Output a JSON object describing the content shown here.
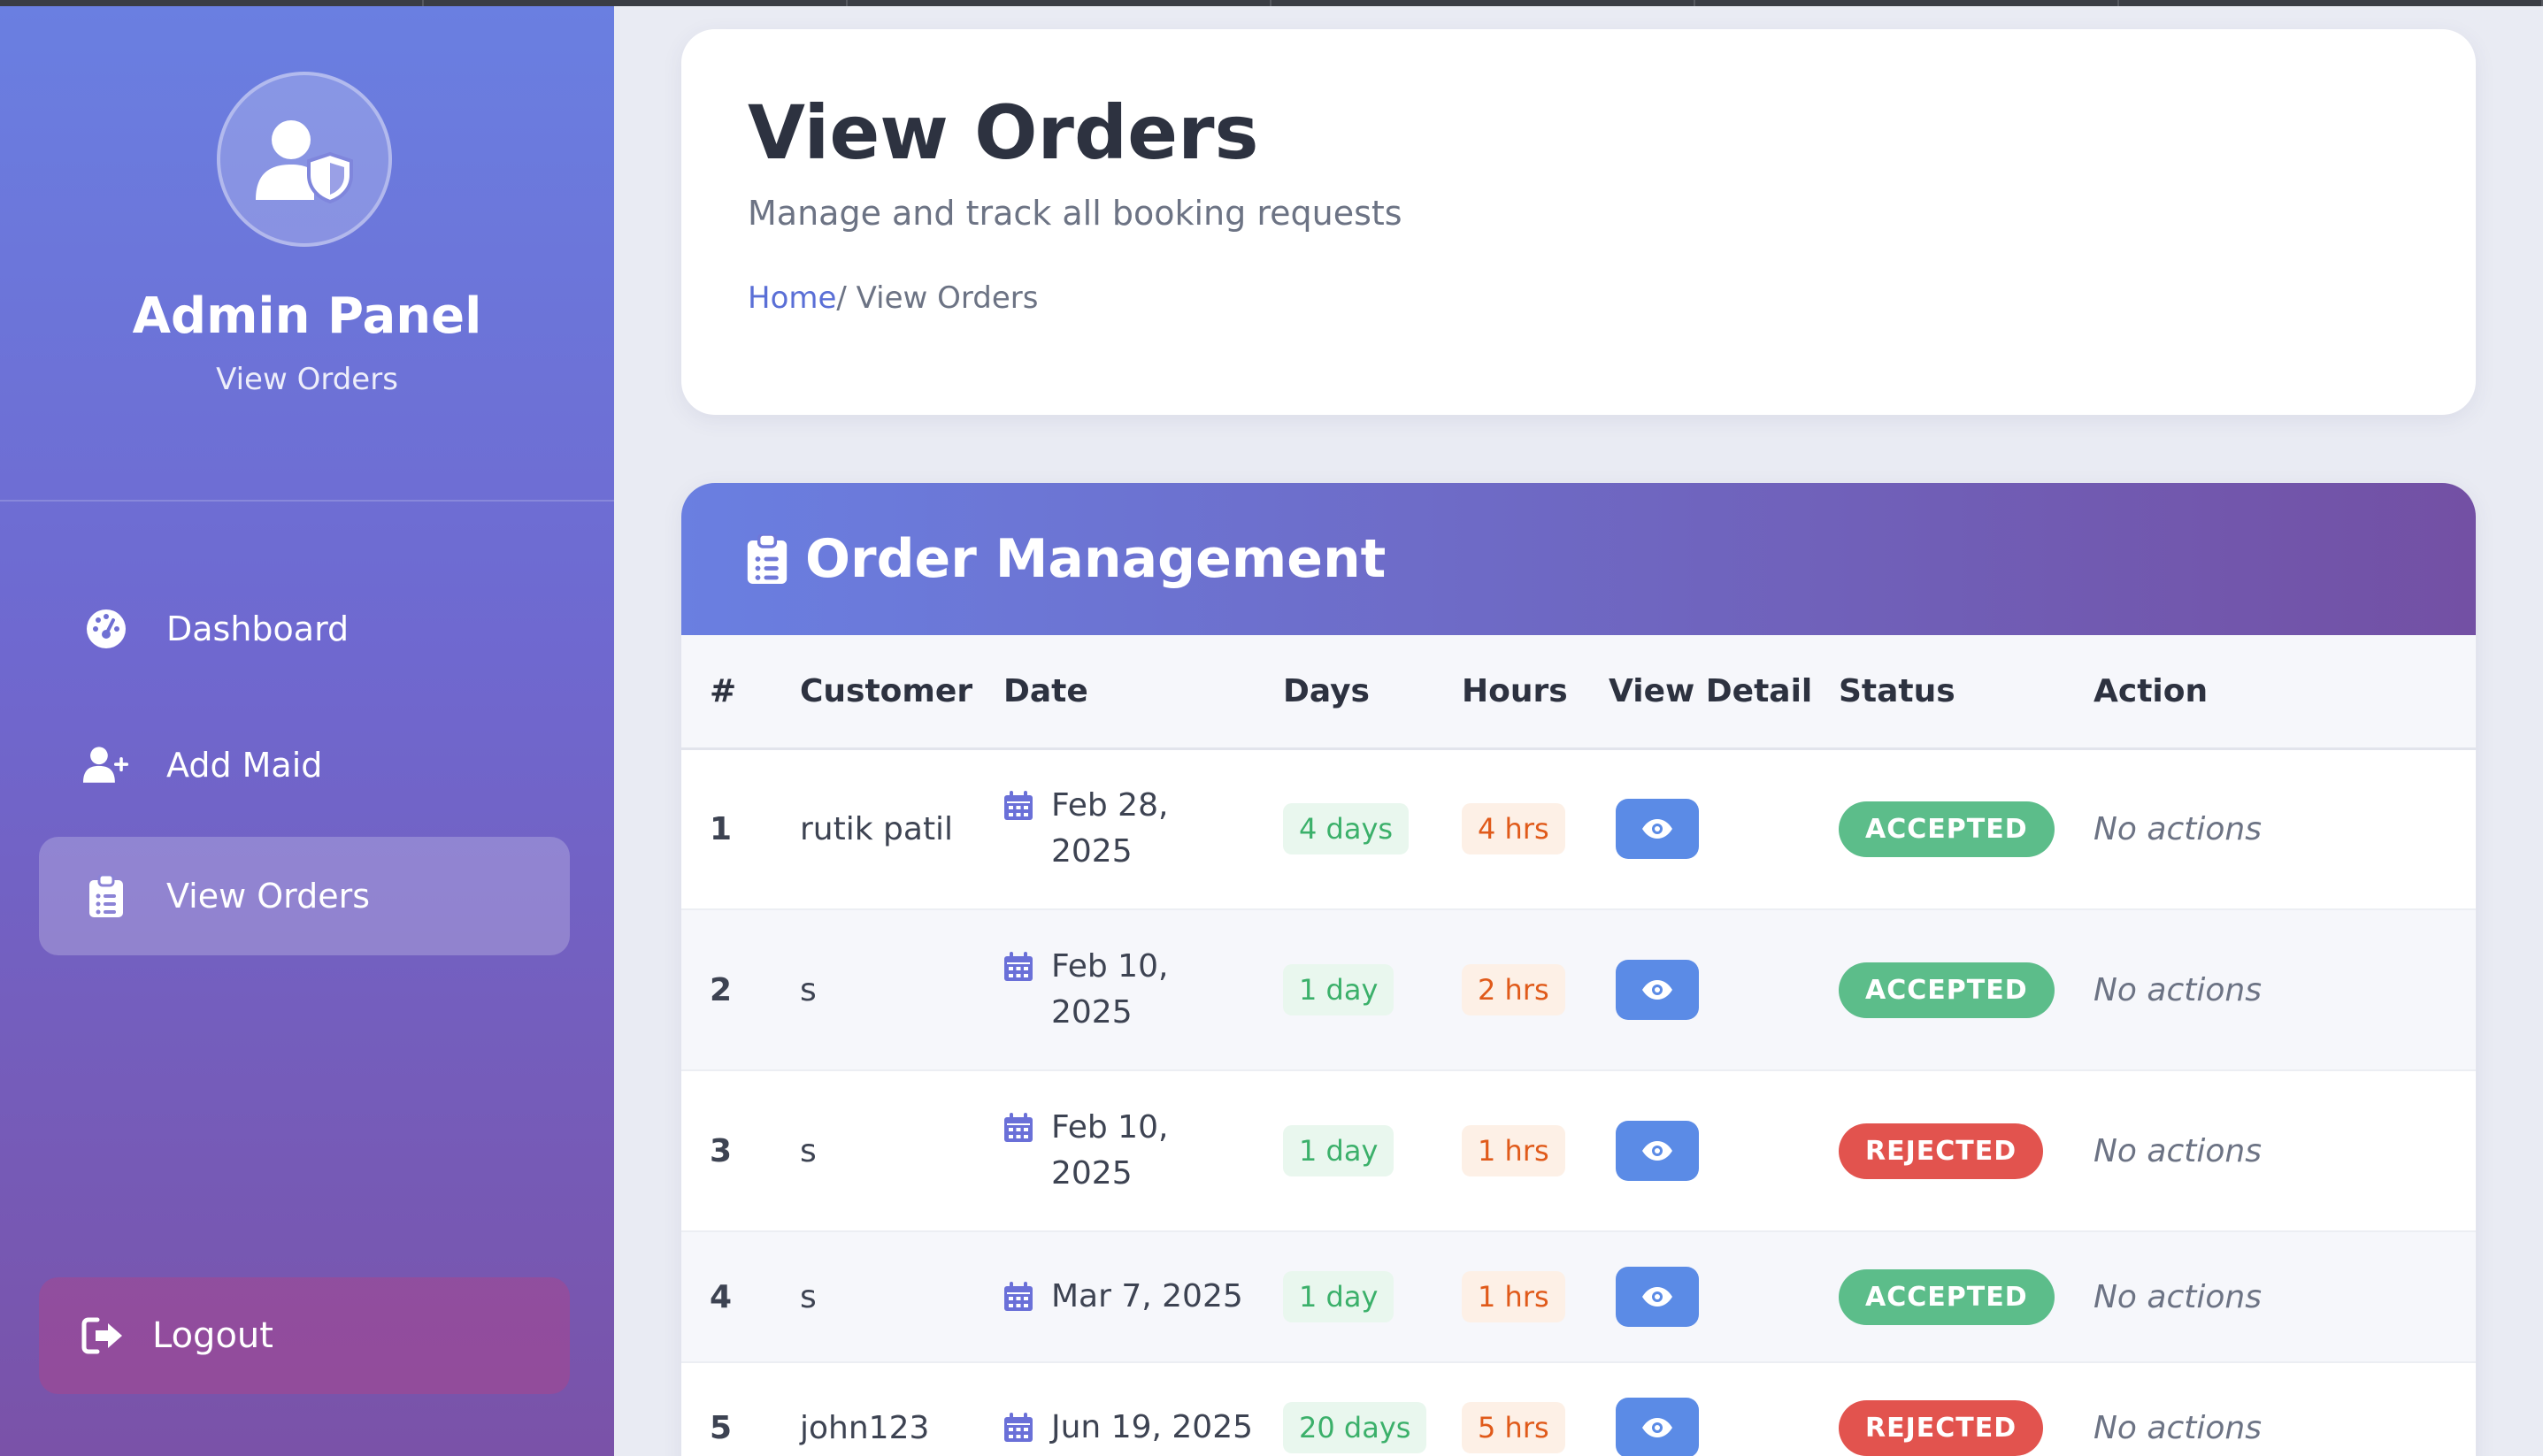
{
  "sidebar": {
    "brand_title": "Admin Panel",
    "brand_subtitle": "View Orders",
    "nav": [
      {
        "label": "Dashboard",
        "icon": "dashboard-gauge-icon"
      },
      {
        "label": "Add Maid",
        "icon": "user-plus-icon"
      },
      {
        "label": "View Orders",
        "icon": "clipboard-list-icon",
        "active": true
      }
    ],
    "logout_label": "Logout"
  },
  "header": {
    "title": "View Orders",
    "subtitle": "Manage and track all booking requests",
    "breadcrumb_home": "Home",
    "breadcrumb_current": "/ View Orders"
  },
  "orders": {
    "title": "Order Management",
    "columns": [
      "#",
      "Customer",
      "Date",
      "Days",
      "Hours",
      "View Detail",
      "Status",
      "Action"
    ],
    "rows": [
      {
        "num": "1",
        "customer": "rutik patil",
        "date": "Feb 28, 2025",
        "days": "4 days",
        "hours": "4 hrs",
        "status": "ACCEPTED",
        "action": "No actions"
      },
      {
        "num": "2",
        "customer": "s",
        "date": "Feb 10, 2025",
        "days": "1 day",
        "hours": "2 hrs",
        "status": "ACCEPTED",
        "action": "No actions"
      },
      {
        "num": "3",
        "customer": "s",
        "date": "Feb 10, 2025",
        "days": "1 day",
        "hours": "1 hrs",
        "status": "REJECTED",
        "action": "No actions"
      },
      {
        "num": "4",
        "customer": "s",
        "date": "Mar 7, 2025",
        "days": "1 day",
        "hours": "1 hrs",
        "status": "ACCEPTED",
        "action": "No actions"
      },
      {
        "num": "5",
        "customer": "john123",
        "date": "Jun 19, 2025",
        "days": "20 days",
        "hours": "5 hrs",
        "status": "REJECTED",
        "action": "No actions"
      }
    ]
  },
  "colors": {
    "accent": "#5a6fd6",
    "accepted": "#5cbd8a",
    "rejected": "#e2534e",
    "view_button": "#5b8be6"
  }
}
